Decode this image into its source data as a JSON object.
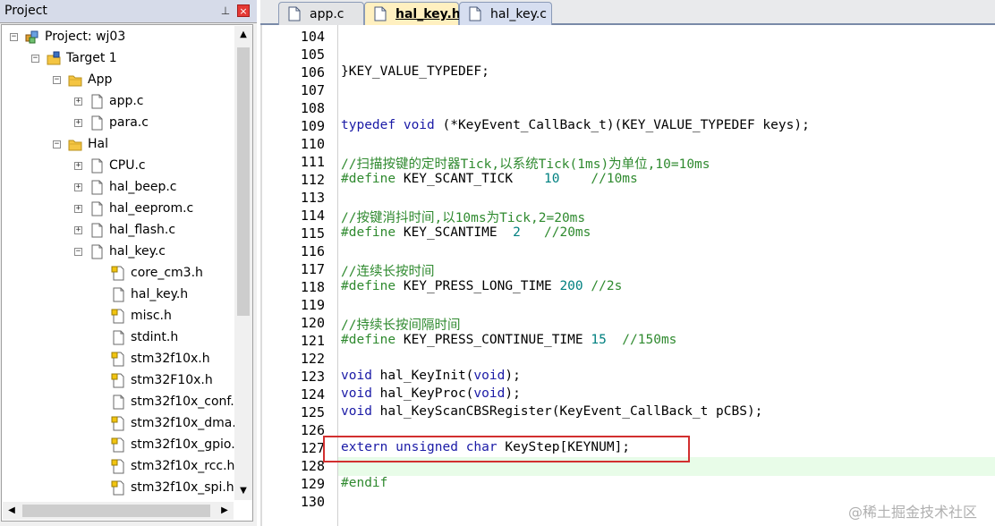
{
  "project_panel": {
    "title": "Project",
    "pin_symbol": "⊥",
    "close_symbol": "×",
    "tree": [
      {
        "label": "Project: wj03",
        "icon": "project-icon",
        "expander": "−",
        "level": 0
      },
      {
        "label": "Target 1",
        "icon": "target-icon",
        "expander": "−",
        "level": 1
      },
      {
        "label": "App",
        "icon": "folder-icon",
        "expander": "−",
        "level": 2
      },
      {
        "label": "app.c",
        "icon": "c-file-icon",
        "expander": "+",
        "level": 3
      },
      {
        "label": "para.c",
        "icon": "c-file-icon",
        "expander": "+",
        "level": 3
      },
      {
        "label": "Hal",
        "icon": "folder-icon",
        "expander": "−",
        "level": 2
      },
      {
        "label": "CPU.c",
        "icon": "c-file-icon",
        "expander": "+",
        "level": 3
      },
      {
        "label": "hal_beep.c",
        "icon": "c-file-icon",
        "expander": "+",
        "level": 3
      },
      {
        "label": "hal_eeprom.c",
        "icon": "c-file-icon",
        "expander": "+",
        "level": 3
      },
      {
        "label": "hal_flash.c",
        "icon": "c-file-icon",
        "expander": "+",
        "level": 3
      },
      {
        "label": "hal_key.c",
        "icon": "c-file-icon",
        "expander": "−",
        "level": 3
      },
      {
        "label": "core_cm3.h",
        "icon": "locked-header-icon",
        "expander": "",
        "level": 4
      },
      {
        "label": "hal_key.h",
        "icon": "header-file-icon",
        "expander": "",
        "level": 4
      },
      {
        "label": "misc.h",
        "icon": "locked-header-icon",
        "expander": "",
        "level": 4
      },
      {
        "label": "stdint.h",
        "icon": "header-file-icon",
        "expander": "",
        "level": 4
      },
      {
        "label": "stm32f10x.h",
        "icon": "locked-header-icon",
        "expander": "",
        "level": 4
      },
      {
        "label": "stm32F10x.h",
        "icon": "locked-header-icon",
        "expander": "",
        "level": 4
      },
      {
        "label": "stm32f10x_conf.h",
        "icon": "header-file-icon",
        "expander": "",
        "level": 4
      },
      {
        "label": "stm32f10x_dma.h",
        "icon": "locked-header-icon",
        "expander": "",
        "level": 4
      },
      {
        "label": "stm32f10x_gpio.h",
        "icon": "locked-header-icon",
        "expander": "",
        "level": 4
      },
      {
        "label": "stm32f10x_rcc.h",
        "icon": "locked-header-icon",
        "expander": "",
        "level": 4
      },
      {
        "label": "stm32f10x_spi.h",
        "icon": "locked-header-icon",
        "expander": "",
        "level": 4
      },
      {
        "label": "",
        "icon": "locked-header-icon",
        "expander": "",
        "level": 4
      }
    ],
    "scroll_up": "▲",
    "scroll_down": "▼",
    "scroll_left": "◀",
    "scroll_right": "▶"
  },
  "editor": {
    "tabs": [
      {
        "label": "app.c",
        "active": false
      },
      {
        "label": "hal_key.h*",
        "active": true
      },
      {
        "label": "hal_key.c",
        "active": false
      }
    ],
    "lines": [
      {
        "n": "104",
        "segments": []
      },
      {
        "n": "105",
        "segments": []
      },
      {
        "n": "106",
        "segments": [
          {
            "t": "}KEY_VALUE_TYPEDEF;",
            "c": ""
          }
        ]
      },
      {
        "n": "107",
        "segments": []
      },
      {
        "n": "108",
        "segments": []
      },
      {
        "n": "109",
        "segments": [
          {
            "t": "typedef",
            "c": "kw"
          },
          {
            "t": " ",
            "c": ""
          },
          {
            "t": "void",
            "c": "kw"
          },
          {
            "t": " (*KeyEvent_CallBack_t)(KEY_VALUE_TYPEDEF keys);",
            "c": ""
          }
        ]
      },
      {
        "n": "110",
        "segments": []
      },
      {
        "n": "111",
        "segments": [
          {
            "t": "//扫描按键的定时器Tick,以系统Tick(1ms)为单位,10=10ms",
            "c": "cm"
          }
        ]
      },
      {
        "n": "112",
        "segments": [
          {
            "t": "#define",
            "c": "cm"
          },
          {
            "t": " KEY_SCANT_TICK    ",
            "c": ""
          },
          {
            "t": "10",
            "c": "num"
          },
          {
            "t": "    ",
            "c": ""
          },
          {
            "t": "//10ms",
            "c": "cm"
          }
        ]
      },
      {
        "n": "113",
        "segments": []
      },
      {
        "n": "114",
        "segments": [
          {
            "t": "//按键消抖时间,以10ms为Tick,2=20ms",
            "c": "cm"
          }
        ]
      },
      {
        "n": "115",
        "segments": [
          {
            "t": "#define",
            "c": "cm"
          },
          {
            "t": " KEY_SCANTIME  ",
            "c": ""
          },
          {
            "t": "2",
            "c": "num"
          },
          {
            "t": "   ",
            "c": ""
          },
          {
            "t": "//20ms",
            "c": "cm"
          }
        ]
      },
      {
        "n": "116",
        "segments": []
      },
      {
        "n": "117",
        "segments": [
          {
            "t": "//连续长按时间",
            "c": "cm"
          }
        ]
      },
      {
        "n": "118",
        "segments": [
          {
            "t": "#define",
            "c": "cm"
          },
          {
            "t": " KEY_PRESS_LONG_TIME ",
            "c": ""
          },
          {
            "t": "200",
            "c": "num"
          },
          {
            "t": " ",
            "c": ""
          },
          {
            "t": "//2s",
            "c": "cm"
          }
        ]
      },
      {
        "n": "119",
        "segments": []
      },
      {
        "n": "120",
        "segments": [
          {
            "t": "//持续长按间隔时间",
            "c": "cm"
          }
        ]
      },
      {
        "n": "121",
        "segments": [
          {
            "t": "#define",
            "c": "cm"
          },
          {
            "t": " KEY_PRESS_CONTINUE_TIME ",
            "c": ""
          },
          {
            "t": "15",
            "c": "num"
          },
          {
            "t": "  ",
            "c": ""
          },
          {
            "t": "//150ms",
            "c": "cm"
          }
        ]
      },
      {
        "n": "122",
        "segments": []
      },
      {
        "n": "123",
        "segments": [
          {
            "t": "void",
            "c": "kw"
          },
          {
            "t": " hal_KeyInit(",
            "c": ""
          },
          {
            "t": "void",
            "c": "kw"
          },
          {
            "t": ");",
            "c": ""
          }
        ]
      },
      {
        "n": "124",
        "segments": [
          {
            "t": "void",
            "c": "kw"
          },
          {
            "t": " hal_KeyProc(",
            "c": ""
          },
          {
            "t": "void",
            "c": "kw"
          },
          {
            "t": ");",
            "c": ""
          }
        ]
      },
      {
        "n": "125",
        "segments": [
          {
            "t": "void",
            "c": "kw"
          },
          {
            "t": " hal_KeyScanCBSRegister(KeyEvent_CallBack_t pCBS);",
            "c": ""
          }
        ]
      },
      {
        "n": "126",
        "segments": []
      },
      {
        "n": "127",
        "segments": [
          {
            "t": "extern",
            "c": "kw"
          },
          {
            "t": " ",
            "c": ""
          },
          {
            "t": "unsigned",
            "c": "kw"
          },
          {
            "t": " ",
            "c": ""
          },
          {
            "t": "char",
            "c": "kw"
          },
          {
            "t": " KeyStep[KEYNUM];",
            "c": ""
          }
        ]
      },
      {
        "n": "128",
        "segments": []
      },
      {
        "n": "129",
        "segments": [
          {
            "t": "#endif",
            "c": "cm"
          }
        ]
      },
      {
        "n": "130",
        "segments": []
      }
    ]
  },
  "watermark": "@稀土掘金技术社区"
}
